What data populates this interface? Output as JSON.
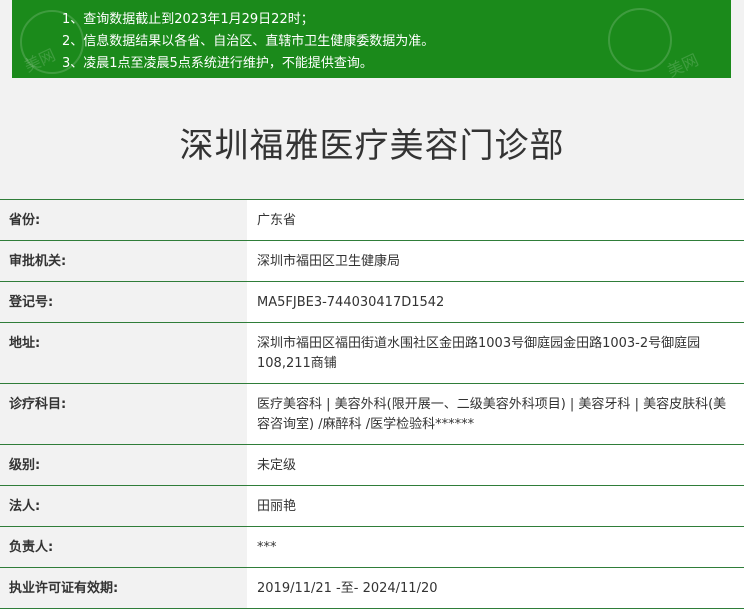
{
  "notice": {
    "lines": [
      "1、查询数据截止到2023年1月29日22时；",
      "2、信息数据结果以各省、自治区、直辖市卫生健康委数据为准。",
      "3、凌晨1点至凌晨5点系统进行维护，不能提供查询。"
    ],
    "watermark": "美网",
    "background_color": "#1b8a1b"
  },
  "title": "深圳福雅医疗美容门诊部",
  "rows": [
    {
      "label": "省份:",
      "value": "广东省"
    },
    {
      "label": "审批机关:",
      "value": "深圳市福田区卫生健康局"
    },
    {
      "label": "登记号:",
      "value": "MA5FJBE3-744030417D1542"
    },
    {
      "label": "地址:",
      "value": "深圳市福田区福田街道水围社区金田路1003号御庭园金田路1003-2号御庭园108,211商铺"
    },
    {
      "label": "诊疗科目:",
      "value": "医疗美容科 | 美容外科(限开展一、二级美容外科项目) | 美容牙科 | 美容皮肤科(美容咨询室) /麻醉科 /医学检验科******"
    },
    {
      "label": "级别:",
      "value": "未定级"
    },
    {
      "label": "法人:",
      "value": "田丽艳"
    },
    {
      "label": "负责人:",
      "value": "***"
    },
    {
      "label": "执业许可证有效期:",
      "value": "2019/11/21 -至- 2024/11/20"
    }
  ],
  "colors": {
    "accent_green": "#1b8a1b",
    "row_border": "#2f7d39",
    "label_bg": "#f2f2f2",
    "value_bg": "#ffffff"
  }
}
